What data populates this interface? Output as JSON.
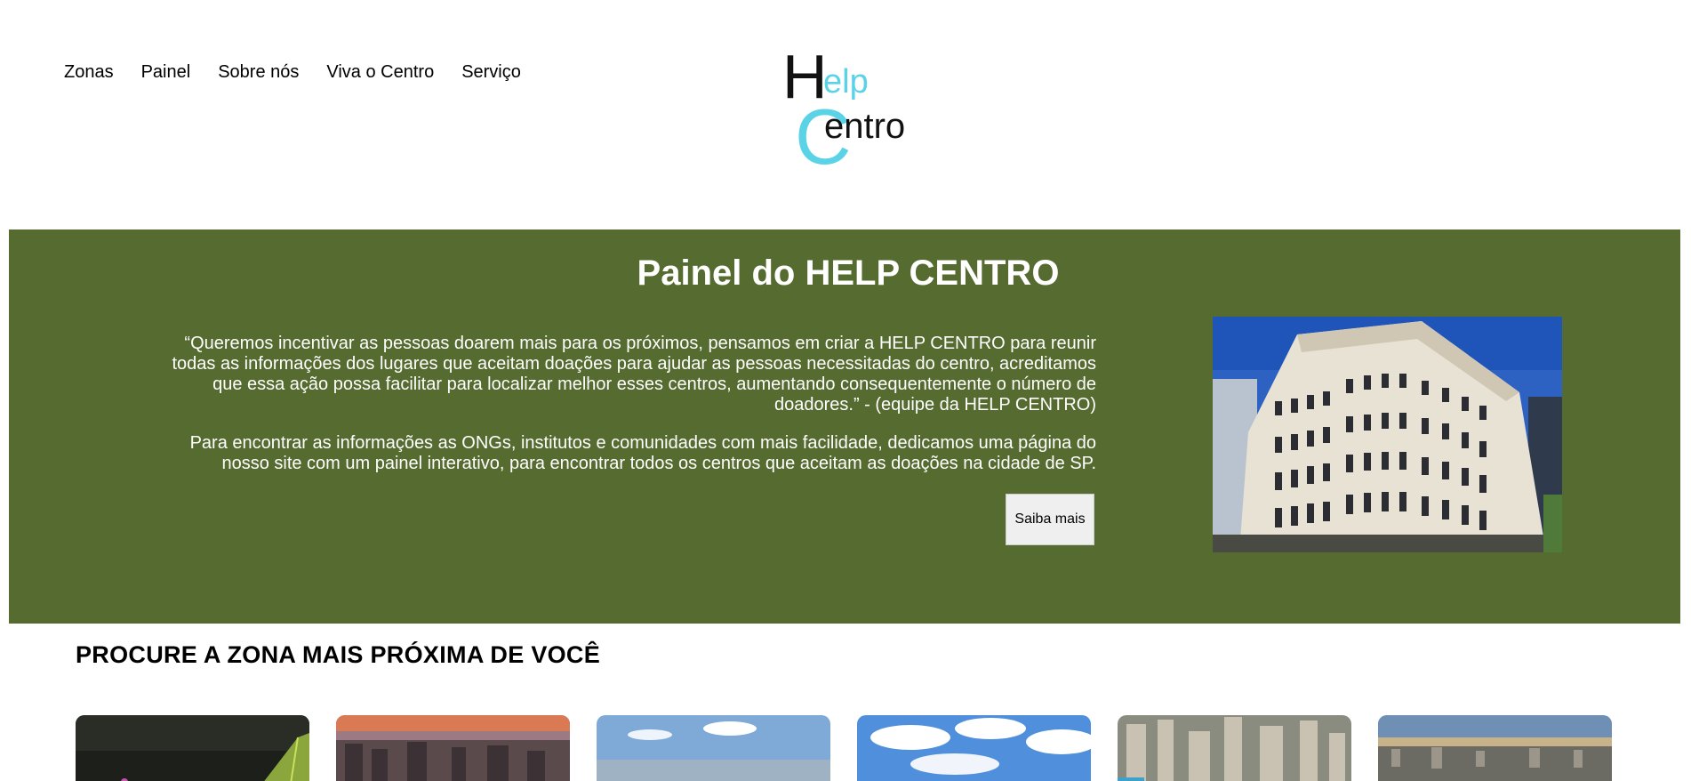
{
  "nav": {
    "items": [
      "Zonas",
      "Painel",
      "Sobre nós",
      "Viva o Centro",
      "Serviço"
    ]
  },
  "logo": {
    "text_help_h": "H",
    "text_help_rest": "elp",
    "text_centro_c": "C",
    "text_centro_rest": "entro",
    "colors": {
      "dark": "#111111",
      "accent": "#5bd3e6"
    }
  },
  "hero": {
    "background": "#556b2f",
    "title": "Painel do HELP CENTRO",
    "paragraph1": "“Queremos incentivar as pessoas doarem mais para os próximos, pensamos em criar a HELP CENTRO para reunir todas as informações dos lugares que aceitam doações para ajudar as pessoas necessitadas do centro, acreditamos que essa ação possa facilitar para localizar melhor esses centros, aumentando consequentemente o número de doadores.” - (equipe da HELP CENTRO)",
    "paragraph2": "Para encontrar as informações as ONGs, institutos e comunidades com mais facilidade, dedicamos uma página do nosso site com um painel interativo, para encontrar todos os centros que aceitam as doações na cidade de SP.",
    "button_label": "Saiba mais"
  },
  "zones_section": {
    "title": "PROCURE A ZONA MAIS PRÓXIMA DE VOCÊ"
  }
}
